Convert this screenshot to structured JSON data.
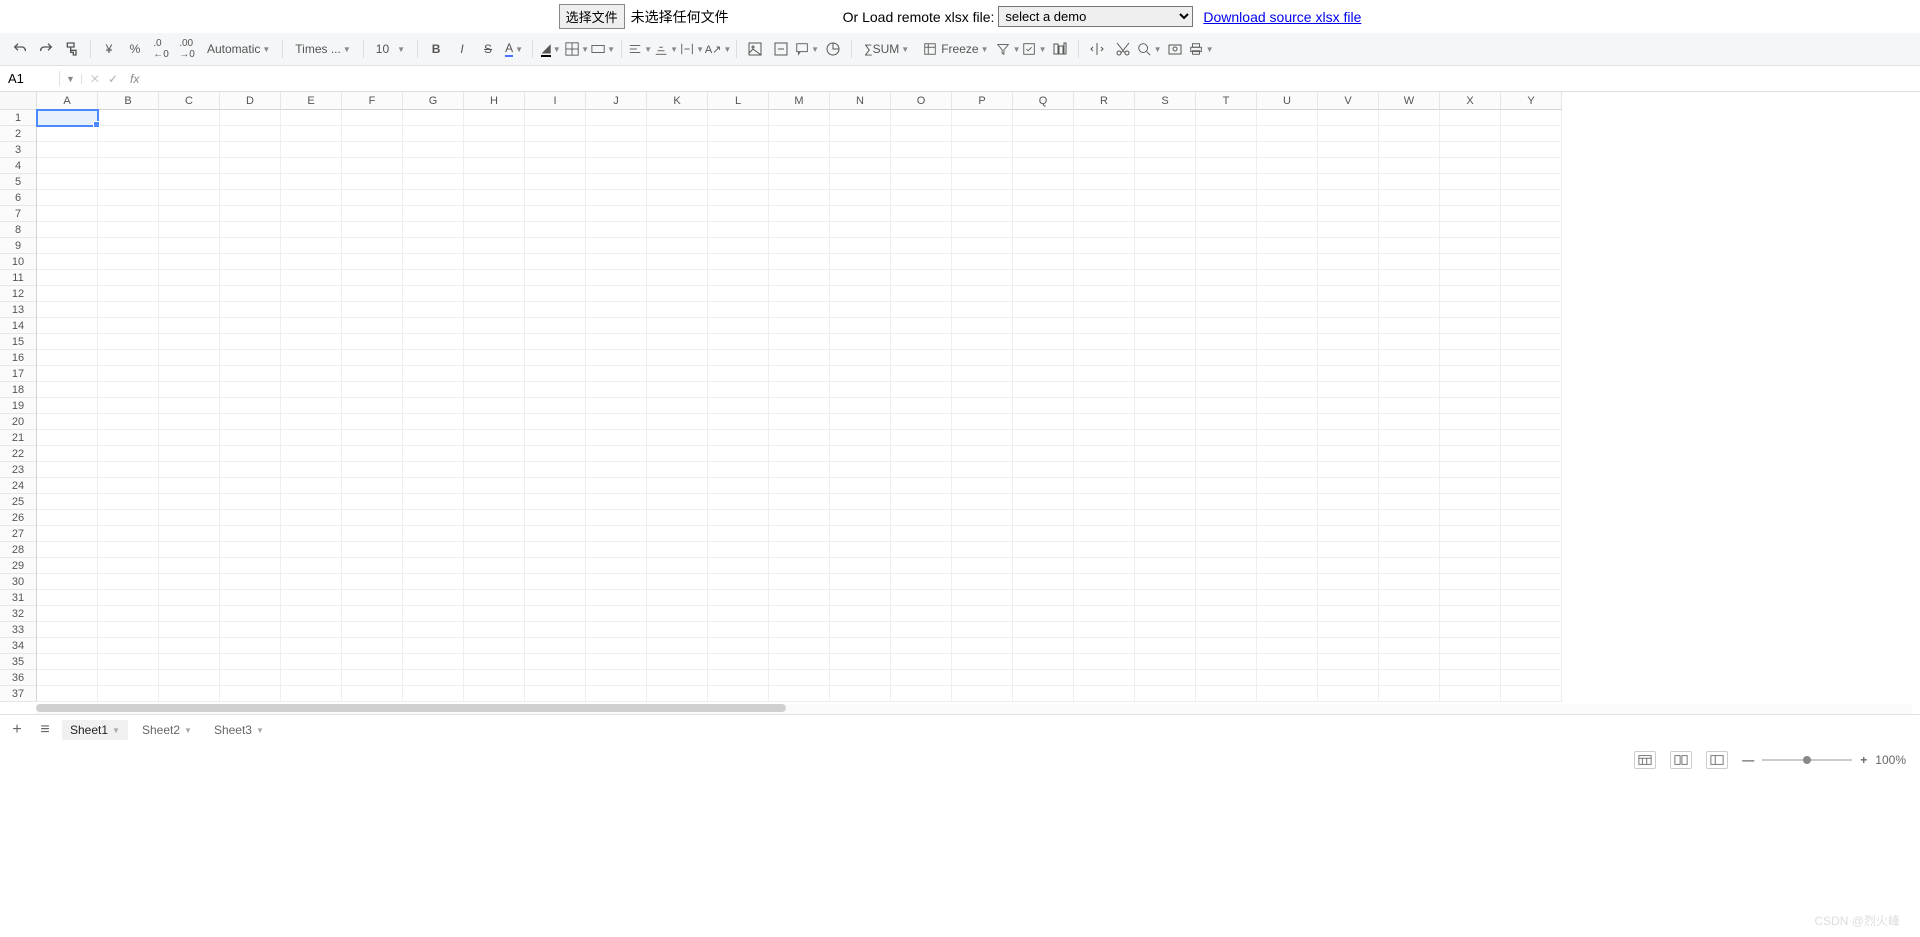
{
  "topBar": {
    "chooseFile": "选择文件",
    "noFile": "未选择任何文件",
    "loadLabel": "Or Load remote xlsx file:",
    "selectDemo": "select a demo",
    "downloadLink": "Download source xlsx file"
  },
  "toolbar": {
    "format": "Automatic",
    "font": "Times ...",
    "fontSize": "10",
    "sum": "SUM",
    "freeze": "Freeze"
  },
  "nameBox": "A1",
  "fxLabel": "fx",
  "columns": [
    "A",
    "B",
    "C",
    "D",
    "E",
    "F",
    "G",
    "H",
    "I",
    "J",
    "K",
    "L",
    "M",
    "N",
    "O",
    "P",
    "Q",
    "R",
    "S",
    "T",
    "U",
    "V",
    "W",
    "X",
    "Y"
  ],
  "rowCount": 37,
  "selectedCell": {
    "row": 1,
    "col": 0
  },
  "sheets": [
    {
      "name": "Sheet1",
      "active": true
    },
    {
      "name": "Sheet2",
      "active": false
    },
    {
      "name": "Sheet3",
      "active": false
    }
  ],
  "zoom": "100%",
  "watermark": "CSDN @烈火峰"
}
